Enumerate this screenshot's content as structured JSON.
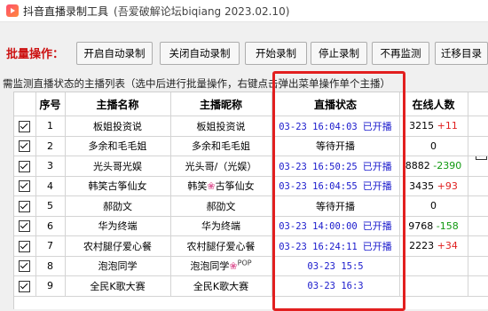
{
  "window": {
    "title": "抖音直播录制工具",
    "subtitle": "(吾爱破解论坛biqiang 2023.02.10)"
  },
  "toolbar": {
    "label": "批量操作：",
    "buttons": [
      "开启自动录制",
      "关闭自动录制",
      "开始录制",
      "停止录制",
      "不再监测",
      "迁移目录"
    ]
  },
  "hint": "需监测直播状态的主播列表（选中后进行批量操作，右键点击弹出菜单操作单个主播）",
  "table": {
    "headers": [
      "序号",
      "主播名称",
      "主播昵称",
      "直播状态",
      "在线人数"
    ],
    "rows": [
      {
        "no": "1",
        "name": "板姐投资说",
        "nick": "板姐投资说",
        "time": "03-23 16:04:03",
        "status": "已开播",
        "online": "3215",
        "delta": "+11"
      },
      {
        "no": "2",
        "name": "多余和毛毛姐",
        "nick": "多余和毛毛姐",
        "time": "",
        "status": "等待开播",
        "online": "0",
        "delta": ""
      },
      {
        "no": "3",
        "name": "光头哥光娱",
        "nick": "光头哥/（光娱）",
        "time": "03-23 16:50:25",
        "status": "已开播",
        "online": "8882",
        "delta": "-2390"
      },
      {
        "no": "4",
        "name": "韩笑古筝仙女",
        "nick": "韩笑古筝仙女",
        "time": "03-23 16:04:55",
        "status": "已开播",
        "online": "3435",
        "delta": "+93"
      },
      {
        "no": "5",
        "name": "郝劭文",
        "nick": "郝劭文",
        "time": "",
        "status": "等待开播",
        "online": "0",
        "delta": ""
      },
      {
        "no": "6",
        "name": "华为终端",
        "nick": "华为终端",
        "time": "03-23 14:00:00",
        "status": "已开播",
        "online": "9768",
        "delta": "-158"
      },
      {
        "no": "7",
        "name": "农村腿仔爱心餐",
        "nick": "农村腿仔爱心餐",
        "time": "03-23 16:24:11",
        "status": "已开播",
        "online": "2223",
        "delta": "+34"
      },
      {
        "no": "8",
        "name": "泡泡同学",
        "nick": "泡泡同学",
        "time": "03-23 15:5",
        "status": "",
        "online": "",
        "delta": ""
      },
      {
        "no": "9",
        "name": "全民K歌大赛",
        "nick": "全民K歌大赛",
        "time": "03-23 16:3",
        "status": "",
        "online": "",
        "delta": ""
      }
    ]
  },
  "nick_badges": {
    "row4_flower": "❀",
    "row8_pop": "POP"
  },
  "colors": {
    "highlight": "#e21f1f",
    "accent_text": "#1a1acc",
    "label_red": "#cc1111"
  }
}
